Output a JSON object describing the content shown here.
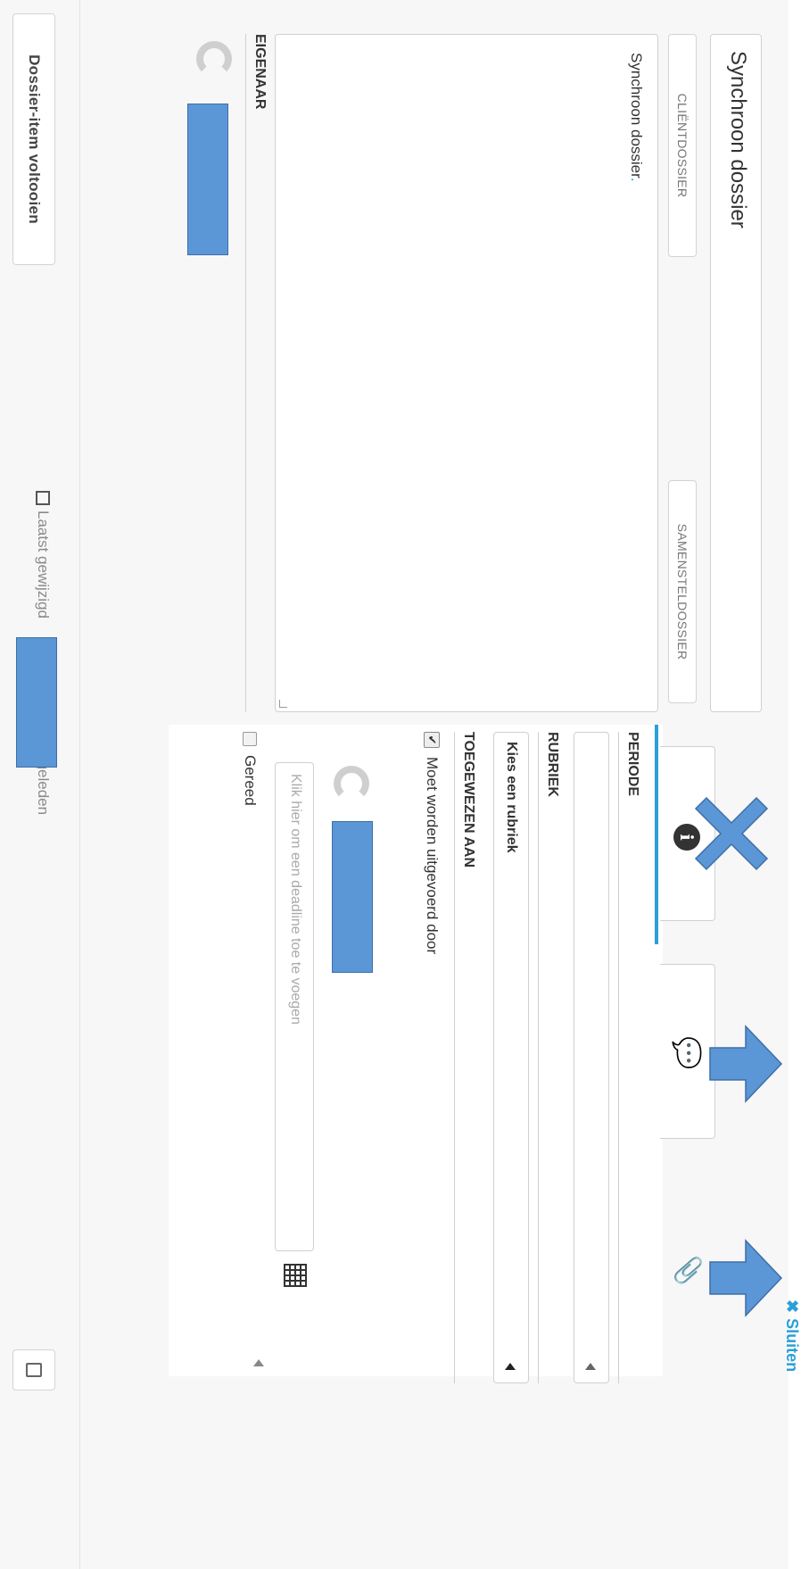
{
  "title_field": {
    "value": "Synchroon dossier"
  },
  "dossier_buttons": {
    "client": "CLIËNTDOSSIER",
    "composite": "SAMENSTELDOSSIER"
  },
  "description": {
    "text": "Synchroon dossier",
    "suffix": "."
  },
  "owner": {
    "label": "EIGENAAR"
  },
  "complete_button": {
    "label": "Dossier-item voltooien"
  },
  "footer": {
    "modified_prefix": "Laatst gewijzigd",
    "modified_suffix": ", één dag geleden"
  },
  "panel": {
    "close_label": "Sluiten",
    "periode_label": "PERIODE",
    "rubriek_label": "RUBRIEK",
    "rubriek_select": "Kies een rubriek",
    "toegewezen_label": "TOEGEWEZEN AAN",
    "must_execute_label": "Moet worden uitgevoerd door",
    "must_execute_checked": true,
    "deadline_placeholder": "Klik hier om een deadline toe te voegen",
    "gereed_label": "Gereed",
    "gereed_checked": false
  },
  "tabs": [
    {
      "name": "info",
      "icon": "info-icon"
    },
    {
      "name": "comments",
      "icon": "comments-icon"
    },
    {
      "name": "attachments",
      "icon": "paperclip-icon"
    }
  ],
  "annotations": {
    "x_color": "#5b96d6",
    "arrow_color": "#5b96d6"
  }
}
